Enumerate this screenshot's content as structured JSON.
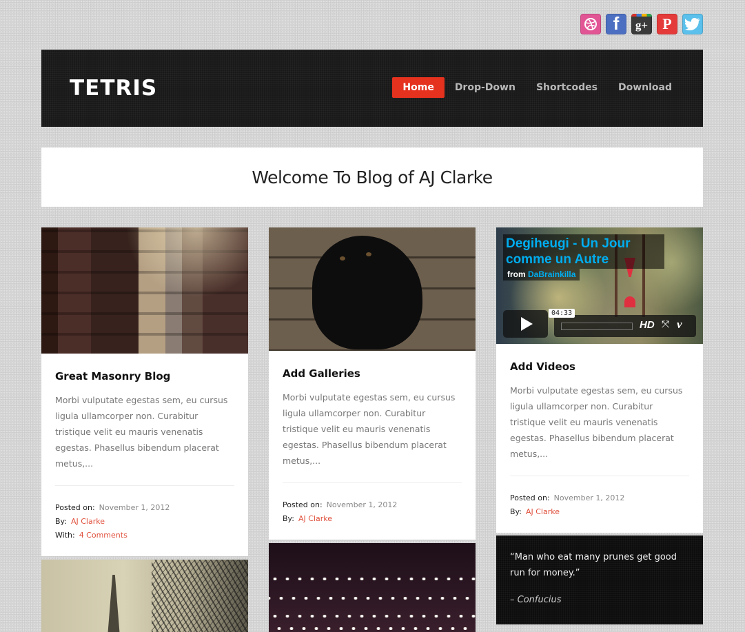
{
  "social": [
    {
      "name": "dribbble",
      "glyph": "◎"
    },
    {
      "name": "facebook",
      "glyph": "f"
    },
    {
      "name": "google-plus",
      "glyph": "g+"
    },
    {
      "name": "pinterest",
      "glyph": "P"
    },
    {
      "name": "twitter",
      "glyph": "🐦"
    }
  ],
  "header": {
    "logo": "TETRIS",
    "nav": [
      {
        "label": "Home",
        "active": true
      },
      {
        "label": "Drop-Down",
        "active": false
      },
      {
        "label": "Shortcodes",
        "active": false
      },
      {
        "label": "Download",
        "active": false
      }
    ]
  },
  "welcome": {
    "title": "Welcome To Blog of AJ Clarke"
  },
  "posts": [
    {
      "title": "Great Masonry Blog",
      "excerpt": "Morbi vulputate egestas sem, eu cursus ligula ullamcorper non. Curabitur tristique velit eu mauris venenatis egestas. Phasellus bibendum placerat metus,...",
      "meta": {
        "posted_label": "Posted on:",
        "date": "November 1, 2012",
        "by_label": "By:",
        "author": "AJ Clarke",
        "with_label": "With:",
        "comments": "4 Comments"
      }
    },
    {
      "title": "Add Galleries",
      "excerpt": "Morbi vulputate egestas sem, eu cursus ligula ullamcorper non. Curabitur tristique velit eu mauris venenatis egestas. Phasellus bibendum placerat metus,...",
      "meta": {
        "posted_label": "Posted on:",
        "date": "November 1, 2012",
        "by_label": "By:",
        "author": "AJ Clarke"
      }
    },
    {
      "title": "Add Videos",
      "excerpt": "Morbi vulputate egestas sem, eu cursus ligula ullamcorper non. Curabitur tristique velit eu mauris venenatis egestas. Phasellus bibendum placerat metus,...",
      "meta": {
        "posted_label": "Posted on:",
        "date": "November 1, 2012",
        "by_label": "By:",
        "author": "AJ Clarke"
      },
      "video": {
        "title": "Degiheugi - Un Jour comme un Autre",
        "from_label": "from",
        "channel": "DaBrainkilla",
        "duration": "04:33",
        "hd_label": "HD",
        "fullscreen_glyph": "⤧",
        "vimeo_glyph": "v"
      }
    }
  ],
  "quote": {
    "text": "“Man who eat many prunes get good run for money.”",
    "author": "– Confucius"
  },
  "colors": {
    "accent": "#e5321f",
    "link": "#e0503c",
    "video_blue": "#00adef"
  }
}
